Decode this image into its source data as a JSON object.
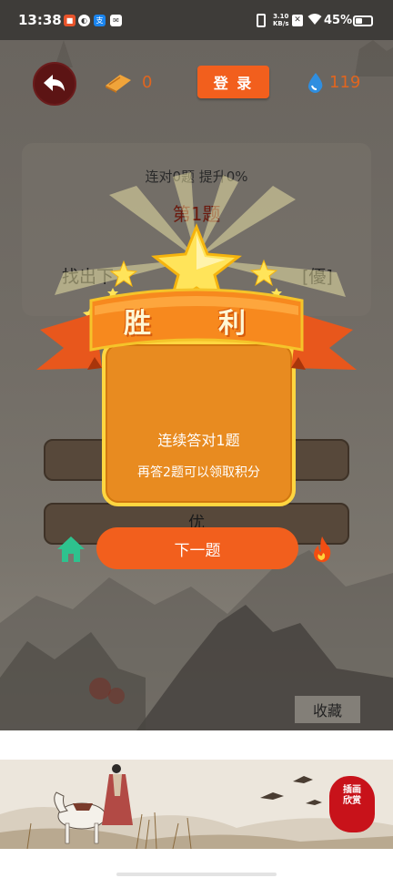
{
  "status_bar": {
    "time": "13:38",
    "speed_value": "3.10",
    "speed_unit": "KB/s",
    "battery_text": "45%",
    "battery_level": 0.45
  },
  "header": {
    "coin_count": "0",
    "login_label": "登 录",
    "water_count": "119"
  },
  "question": {
    "streak_text": "连对0题 提升0%",
    "number_label": "第1题",
    "prompt": "找出下",
    "target": "[優]"
  },
  "options": [
    {
      "label": ""
    },
    {
      "label": "优"
    }
  ],
  "footer": {
    "next_label": "下一题",
    "favorite_label": "收藏"
  },
  "victory_popup": {
    "banner_char1": "胜",
    "banner_char2": "利",
    "line1": "连续答对1题",
    "line2": "再答2题可以领取积分"
  },
  "ad": {
    "seal_text": "插画欣赏"
  },
  "colors": {
    "accent": "#f25f1d",
    "count_text": "#e0651f",
    "popup_orange": "#e88b20",
    "popup_border": "#ffd640",
    "back_button": "#5c1414",
    "home_icon": "#2ec28e",
    "seal": "#c8121a"
  }
}
